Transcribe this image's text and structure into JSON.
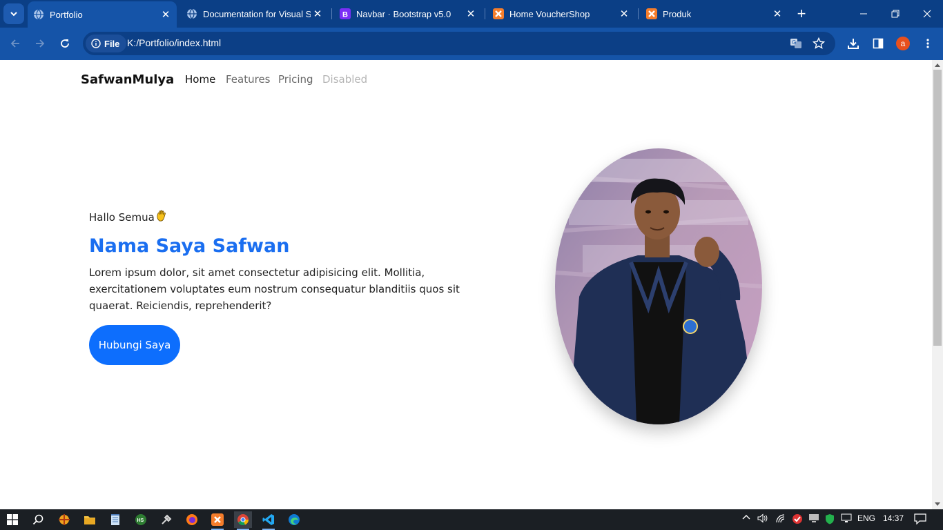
{
  "browser": {
    "tabs": [
      {
        "title": "Portfolio",
        "favicon": "globe-icon",
        "active": true
      },
      {
        "title": "Documentation for Visual Studio Code",
        "favicon": "globe-icon",
        "active": false
      },
      {
        "title": "Navbar · Bootstrap v5.0",
        "favicon": "bootstrap-icon",
        "active": false
      },
      {
        "title": "Home VoucherShop",
        "favicon": "xampp-icon",
        "active": false
      },
      {
        "title": "Produk",
        "favicon": "xampp-icon",
        "active": false
      }
    ],
    "new_tab_label": "+",
    "site_info_label": "File",
    "url": "K:/Portfolio/index.html",
    "profile_initial": "a",
    "colors": {
      "frame": "#0b3f86",
      "toolbar": "#1554a8",
      "omnibox": "#0c3f86"
    }
  },
  "page": {
    "navbar": {
      "brand": "SafwanMulya",
      "links": [
        {
          "label": "Home",
          "state": "active"
        },
        {
          "label": "Features",
          "state": "normal"
        },
        {
          "label": "Pricing",
          "state": "normal"
        },
        {
          "label": "Disabled",
          "state": "disabled"
        }
      ]
    },
    "hero": {
      "greeting": "Hallo Semua",
      "greeting_icon": "waving-hand-icon",
      "title": "Nama Saya Safwan",
      "description": "Lorem ipsum dolor, sit amet consectetur adipisicing elit. Mollitia, exercitationem voluptates eum nostrum consequatur blanditiis quos sit quaerat. Reiciendis, reprehenderit?",
      "cta": "Hubungi Saya",
      "photo_alt": "profile-photo",
      "colors": {
        "title": "#1a6ef0",
        "button": "#0d6efd"
      }
    }
  },
  "taskbar": {
    "apps": [
      "windows-start-icon",
      "search-icon",
      "app-orange-icon",
      "file-explorer-icon",
      "notepad-icon",
      "app-hs-icon",
      "tool-icon",
      "firefox-icon",
      "xampp-icon",
      "chrome-icon",
      "vscode-icon",
      "edge-icon"
    ],
    "language": "ENG",
    "time": "14:37"
  }
}
